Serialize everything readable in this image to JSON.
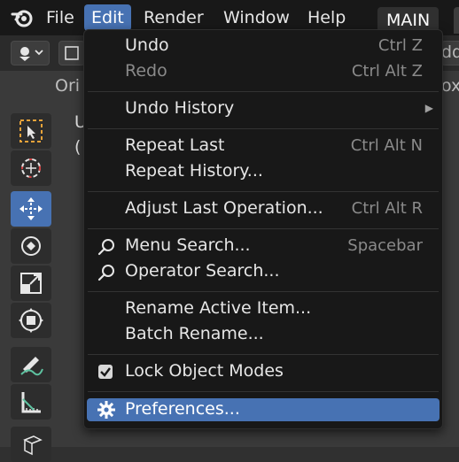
{
  "menubar": {
    "items": [
      "File",
      "Edit",
      "Render",
      "Window",
      "Help"
    ],
    "workspace_tab": "MAIN"
  },
  "header": {
    "left_text": "Ori",
    "right_text": "dd",
    "right_text2": "ox"
  },
  "viewport": {
    "text_line1": "U",
    "text_line2": "("
  },
  "edit_menu": {
    "items": [
      {
        "label": "Undo",
        "shortcut": "Ctrl Z"
      },
      {
        "label": "Redo",
        "shortcut": "Ctrl Alt Z"
      },
      {
        "label": "Undo History"
      },
      {
        "label": "Repeat Last",
        "shortcut": "Ctrl Alt N"
      },
      {
        "label": "Repeat History..."
      },
      {
        "label": "Adjust Last Operation...",
        "shortcut": "Ctrl Alt R"
      },
      {
        "label": "Menu Search...",
        "shortcut": "Spacebar"
      },
      {
        "label": "Operator Search..."
      },
      {
        "label": "Rename Active Item..."
      },
      {
        "label": "Batch Rename..."
      },
      {
        "label": "Lock Object Modes",
        "checked": true
      },
      {
        "label": "Preferences..."
      }
    ]
  },
  "colors": {
    "accent": "#4772b3",
    "menu_bg": "#181818",
    "viewport_bg": "#3a3a3a"
  }
}
